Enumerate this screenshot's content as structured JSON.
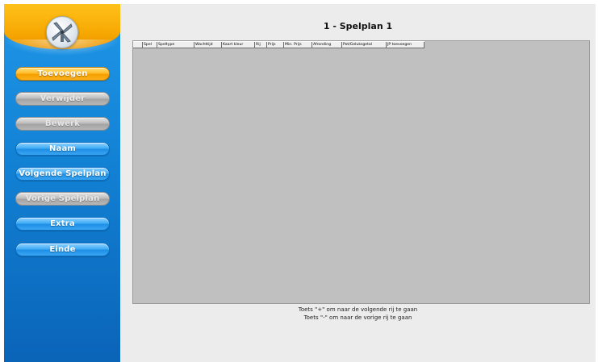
{
  "title": "1 - Spelplan 1",
  "sidebar": {
    "buttons": [
      {
        "label": "Toevoegen",
        "state": "active"
      },
      {
        "label": "Verwijder",
        "state": "disabled"
      },
      {
        "label": "Bewerk",
        "state": "disabled"
      },
      {
        "label": "Naam",
        "state": "enabled"
      },
      {
        "label": "Volgende Spelplan",
        "state": "enabled"
      },
      {
        "label": "Vorige Spelplan",
        "state": "disabled"
      },
      {
        "label": "Extra",
        "state": "enabled"
      },
      {
        "label": "Einde",
        "state": "enabled"
      }
    ]
  },
  "grid": {
    "columns": [
      "",
      "Spel",
      "Speltype",
      "Wachttijd",
      "Kaart kleur",
      "Rij",
      "Prijs",
      "Min. Prijs",
      "Afronding",
      "Pot/Geluksgetal",
      "JP toevoegen"
    ]
  },
  "hints": {
    "next_row": "Toets \"+\" om naar de volgende rij te gaan",
    "prev_row": "Toets \"-\" om naar de vorige rij te gaan"
  },
  "colors": {
    "accent_orange": "#f6a500",
    "sidebar_blue": "#1281d4",
    "grid_gray": "#c0c0c0"
  },
  "icons": {
    "logo": "windmill-icon"
  }
}
